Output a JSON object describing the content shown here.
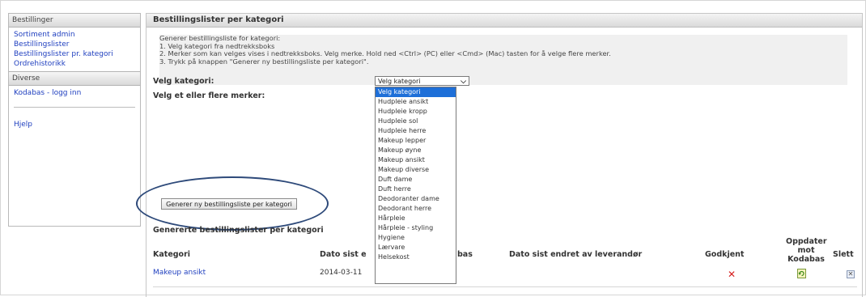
{
  "sidebar": {
    "section1": "Bestillinger",
    "links1": [
      "Sortiment admin",
      "Bestillingslister",
      "Bestillingslister pr. kategori",
      "Ordrehistorikk"
    ],
    "section2": "Diverse",
    "links2": [
      "Kodabas - logg inn"
    ],
    "help": "Hjelp"
  },
  "main": {
    "title": "Bestillingslister per kategori",
    "instructions": [
      "Generer bestillingsliste for kategori:",
      "1. Velg kategori fra nedtrekksboks",
      "2. Merker som kan velges vises i nedtrekksboks. Velg merke. Hold ned <Ctrl> (PC) eller <Cmd> (Mac) tasten for å velge flere merker.",
      "3. Trykk på knappen \"Generer ny bestillingsliste per kategori\"."
    ],
    "category_label": "Velg kategori:",
    "brands_label": "Velg et eller flere merker:",
    "category_select": {
      "value": "Velg kategori",
      "options": [
        "Velg kategori",
        "Hudpleie ansikt",
        "Hudpleie kropp",
        "Hudpleie sol",
        "Hudpleie herre",
        "Makeup lepper",
        "Makeup øyne",
        "Makeup ansikt",
        "Makeup diverse",
        "Duft dame",
        "Duft herre",
        "Deodoranter dame",
        "Deodorant herre",
        "Hårpleie",
        "Hårpleie - styling",
        "Hygiene",
        "Lærvare",
        "Helsekost"
      ],
      "selected_index": 0
    },
    "generate_button": "Generer ny bestillingsliste per kategori"
  },
  "generated": {
    "title": "Genererte bestillingslister per kategori",
    "headers": {
      "kategori": "Kategori",
      "dato_sist": "Dato sist e",
      "kodabas": "bas",
      "dato_endret": "Dato sist endret av leverandør",
      "godkjent": "Godkjent",
      "oppdater": [
        "Oppdater",
        "mot",
        "Kodabas"
      ],
      "slett": "Slett"
    },
    "rows": [
      {
        "kategori": "Makeup ansikt",
        "dato": "2014-03-11"
      }
    ]
  },
  "colors": {
    "link": "#1f3fbf",
    "selected_option": "#1e6fd8",
    "not_approved": "#d62020",
    "annotation_ellipse": "#2e4a7a"
  }
}
